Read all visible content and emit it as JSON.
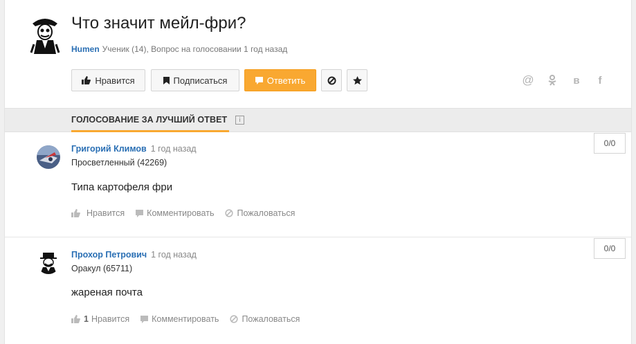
{
  "question": {
    "title": "Что значит мейл-фри?",
    "author": "Humen",
    "meta": "Ученик (14), Вопрос на голосовании 1 год назад"
  },
  "actions": {
    "like_label": "Нравится",
    "subscribe_label": "Подписаться",
    "answer_label": "Ответить"
  },
  "share": {
    "mail": "@",
    "ok": "ok",
    "vk": "в",
    "fb": "f"
  },
  "tab": {
    "label": "ГОЛОСОВАНИЕ ЗА ЛУЧШИЙ ОТВЕТ",
    "info": "i"
  },
  "answers": [
    {
      "name": "Григорий Климов",
      "time": "1 год назад",
      "rank": "Просветленный (42269)",
      "text": "Типа картофеля фри",
      "likes": "",
      "like_label": "Нравится",
      "comment_label": "Комментировать",
      "report_label": "Пожаловаться",
      "score": "0/0"
    },
    {
      "name": "Прохор Петрович",
      "time": "1 год назад",
      "rank": "Оракул (65711)",
      "text": "жареная почта",
      "likes": "1",
      "like_label": "Нравится",
      "comment_label": "Комментировать",
      "report_label": "Пожаловаться",
      "score": "0/0"
    }
  ],
  "colors": {
    "accent": "#f9a831",
    "link": "#2a6fb4"
  }
}
